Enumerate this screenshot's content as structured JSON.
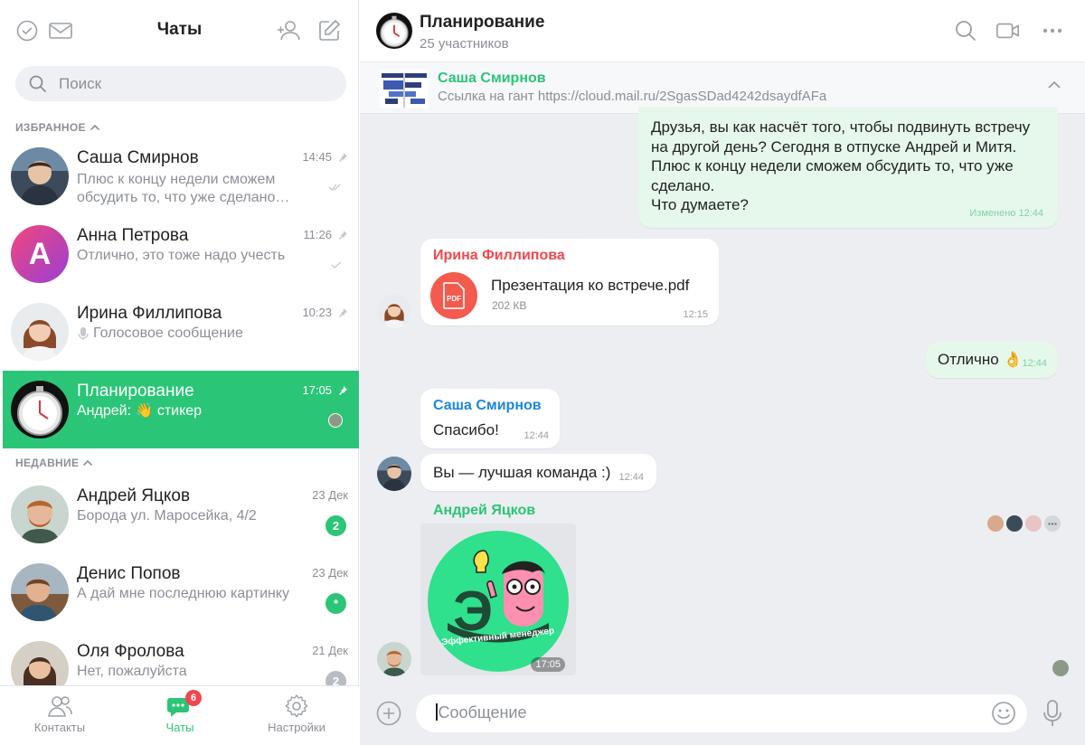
{
  "sidebar": {
    "title": "Чаты",
    "search_placeholder": "Поиск",
    "favorites_label": "ИЗБРАННОЕ",
    "recent_label": "НЕДАВНИЕ",
    "favorites": [
      {
        "name": "Саша Смирнов",
        "time": "14:45",
        "preview": "Плюс к концу недели сможем обсудить то, что уже сделано…"
      },
      {
        "name": "Анна Петрова",
        "time": "11:26",
        "preview": "Отлично, это тоже надо учесть",
        "initial": "А"
      },
      {
        "name": "Ирина Филлипова",
        "time": "10:23",
        "preview": "Голосовое сообщение"
      },
      {
        "name": "Планирование",
        "time": "17:05",
        "preview": "Андрей: 👋 стикер"
      }
    ],
    "recent": [
      {
        "name": "Андрей Яцков",
        "time": "23 Дек",
        "preview": "Борода ул. Маросейка, 4/2",
        "badge": "2"
      },
      {
        "name": "Денис Попов",
        "time": "23 Дек",
        "preview": "А дай мне последнюю картинку",
        "badge": "*"
      },
      {
        "name": "Оля Фролова",
        "time": "21 Дек",
        "preview": "Нет, пожалуйста",
        "badge": "2"
      }
    ],
    "nav": {
      "contacts": "Контакты",
      "chats": "Чаты",
      "settings": "Настройки",
      "chats_badge": "6"
    }
  },
  "chat": {
    "title": "Планирование",
    "subtitle": "25 участников",
    "pinned": {
      "author": "Саша Смирнов",
      "text": "Ссылка на гант https://cloud.mail.ru/2SgasSDad4242dsaydfAFa"
    },
    "messages": {
      "m1": {
        "lines": [
          "Друзья, вы как насчёт того, чтобы подвинуть встречу",
          "на другой день? Сегодня в отпуске Андрей и Митя.",
          "Плюс к концу недели сможем обсудить то, что уже",
          "сделано.",
          "Что думаете?"
        ],
        "time": "Изменено 12:44"
      },
      "m2": {
        "author": "Ирина Филлипова",
        "file_name": "Презентация ко встрече.pdf",
        "file_size": "202 КВ",
        "file_ext": "PDF",
        "time": "12:15"
      },
      "m3": {
        "text": "Отлично 👌",
        "time": "12:44"
      },
      "m4": {
        "author": "Саша Смирнов",
        "text": "Спасибо!",
        "time": "12:44"
      },
      "m5": {
        "text": "Вы — лучшая команда :)",
        "time": "12:44"
      },
      "m6": {
        "author": "Андрей Яцков",
        "sticker_text": "Эффективный менеджер",
        "sticker_letter": "Э",
        "time": "17:05"
      }
    },
    "composer_placeholder": "Сообщение"
  },
  "colors": {
    "accent": "#2bc577",
    "link_blue": "#1a86e0",
    "red_author": "#f2474c"
  }
}
